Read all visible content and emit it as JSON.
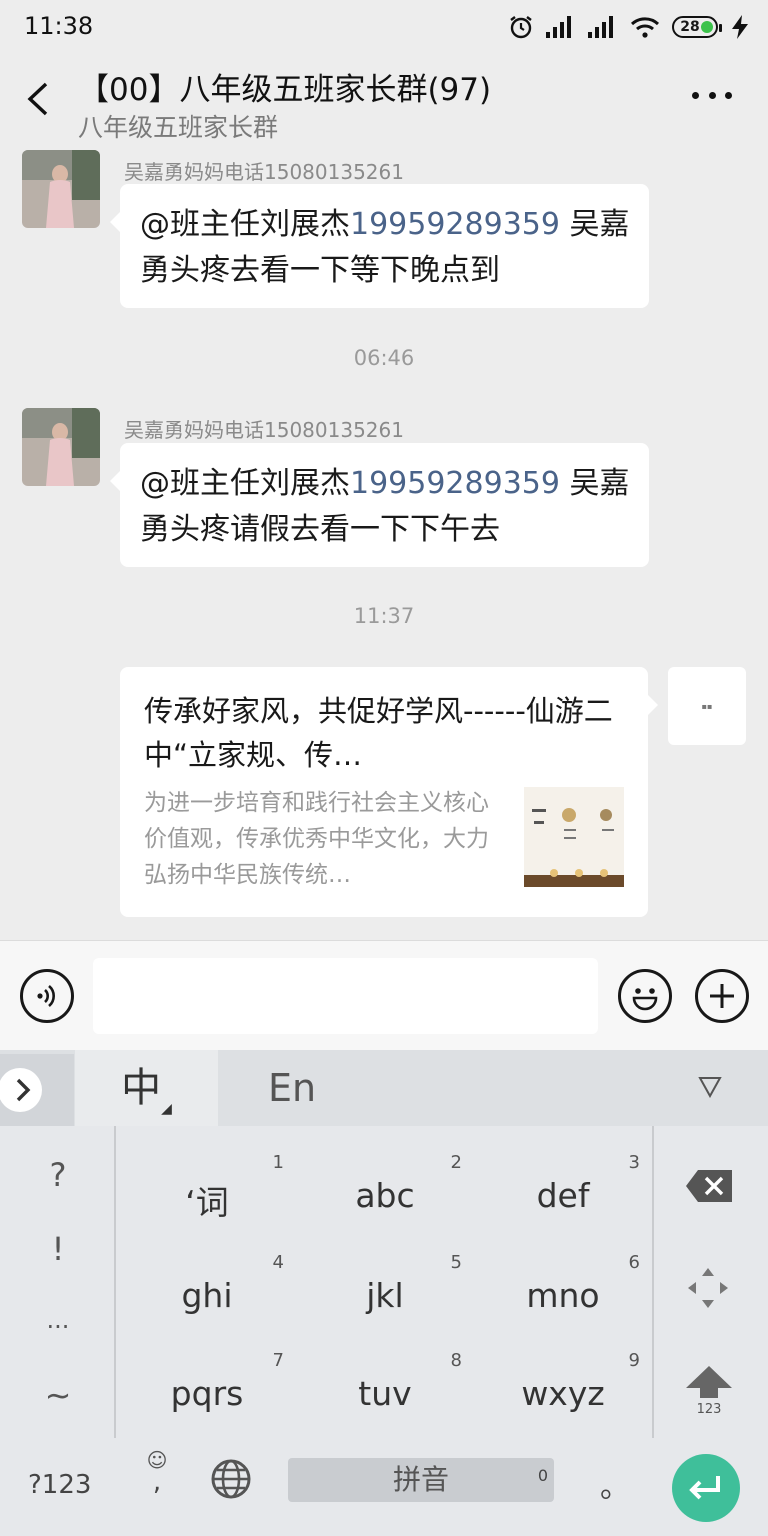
{
  "status_bar": {
    "time": "11:38",
    "battery": "28"
  },
  "header": {
    "title": "【00】八年级五班家长群(97)",
    "subtitle": "八年级五班家长群"
  },
  "messages": [
    {
      "sender": "吴嘉勇妈妈电话15080135261",
      "mention": "@班主任刘展杰",
      "mention_phone": "19959289359",
      "text": " 吴嘉勇头疼去看一下等下晚点到"
    },
    {
      "timestamp": "06:46"
    },
    {
      "sender": "吴嘉勇妈妈电话15080135261",
      "mention": "@班主任刘展杰",
      "mention_phone": "19959289359",
      "text": " 吴嘉勇头疼请假去看一下下午去"
    },
    {
      "timestamp": "11:37"
    }
  ],
  "share_card": {
    "title": "传承好家风，共促好学风------仙游二中“立家规、传…",
    "description": "为进一步培育和践行社会主义核心价值观，传承优秀中华文化，大力弘扬中华民族传统…"
  },
  "keyboard": {
    "mode_chinese": "中",
    "mode_english": "En",
    "punct": [
      "?",
      "!",
      "...",
      "~"
    ],
    "keys": [
      {
        "num": "1",
        "label": "‘词"
      },
      {
        "num": "2",
        "label": "abc"
      },
      {
        "num": "3",
        "label": "def"
      },
      {
        "num": "4",
        "label": "ghi"
      },
      {
        "num": "5",
        "label": "jkl"
      },
      {
        "num": "6",
        "label": "mno"
      },
      {
        "num": "7",
        "label": "pqrs"
      },
      {
        "num": "8",
        "label": "tuv"
      },
      {
        "num": "9",
        "label": "wxyz"
      }
    ],
    "sym_key": "?123",
    "comma": ",",
    "space_label": "拼音",
    "space_num": "0",
    "period": "。",
    "shift_label": "123"
  }
}
